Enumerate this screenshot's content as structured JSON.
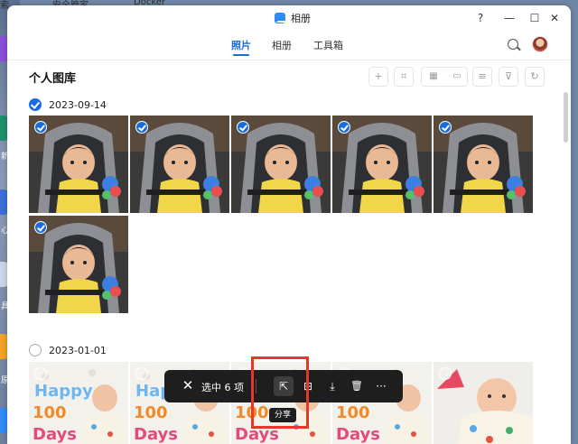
{
  "desktop": {
    "top_items": [
      "索",
      "安全管家",
      "Docker"
    ],
    "side_glyphs": [
      "新",
      "心",
      "具",
      "原"
    ]
  },
  "window": {
    "title": "相册",
    "controls": {
      "help": "?",
      "minimize": "—",
      "maximize": "☐",
      "close": "✕"
    }
  },
  "tabs": [
    {
      "label": "照片",
      "active": true
    },
    {
      "label": "相册",
      "active": false
    },
    {
      "label": "工具箱",
      "active": false
    }
  ],
  "page": {
    "title": "个人图库"
  },
  "toolbar": {
    "icons": [
      "plus-icon",
      "scan-face-icon",
      "grid-view-icon",
      "folder-view-icon",
      "list-icon",
      "filter-icon",
      "refresh-icon"
    ],
    "glyphs": {
      "add": "+",
      "scan": "⌗",
      "grid": "▦",
      "folder": "▭",
      "list": "≡",
      "filter": "⊽",
      "refresh": "↻"
    }
  },
  "groups": [
    {
      "date": "2023-09-14",
      "selected": true,
      "photo_count": 6,
      "photos_selected": [
        true,
        true,
        true,
        true,
        true,
        true
      ]
    },
    {
      "date": "2023-01-01",
      "selected": false,
      "photo_count": 5,
      "photos_selected": [
        false,
        false,
        false,
        false,
        false
      ]
    }
  ],
  "action_bar": {
    "close_glyph": "✕",
    "selection_label": "选中 6 项",
    "buttons": [
      "share-icon",
      "add-to-album-icon",
      "download-icon",
      "delete-icon",
      "more-icon"
    ],
    "glyphs": {
      "share": "⇱",
      "add_album": "⊞",
      "download": "⤓",
      "delete": "🗑",
      "more": "···"
    },
    "tooltip": "分享"
  },
  "colors": {
    "accent": "#1a6be0",
    "highlight": "#e53928",
    "action_bar_bg": "#1e1e1e"
  }
}
